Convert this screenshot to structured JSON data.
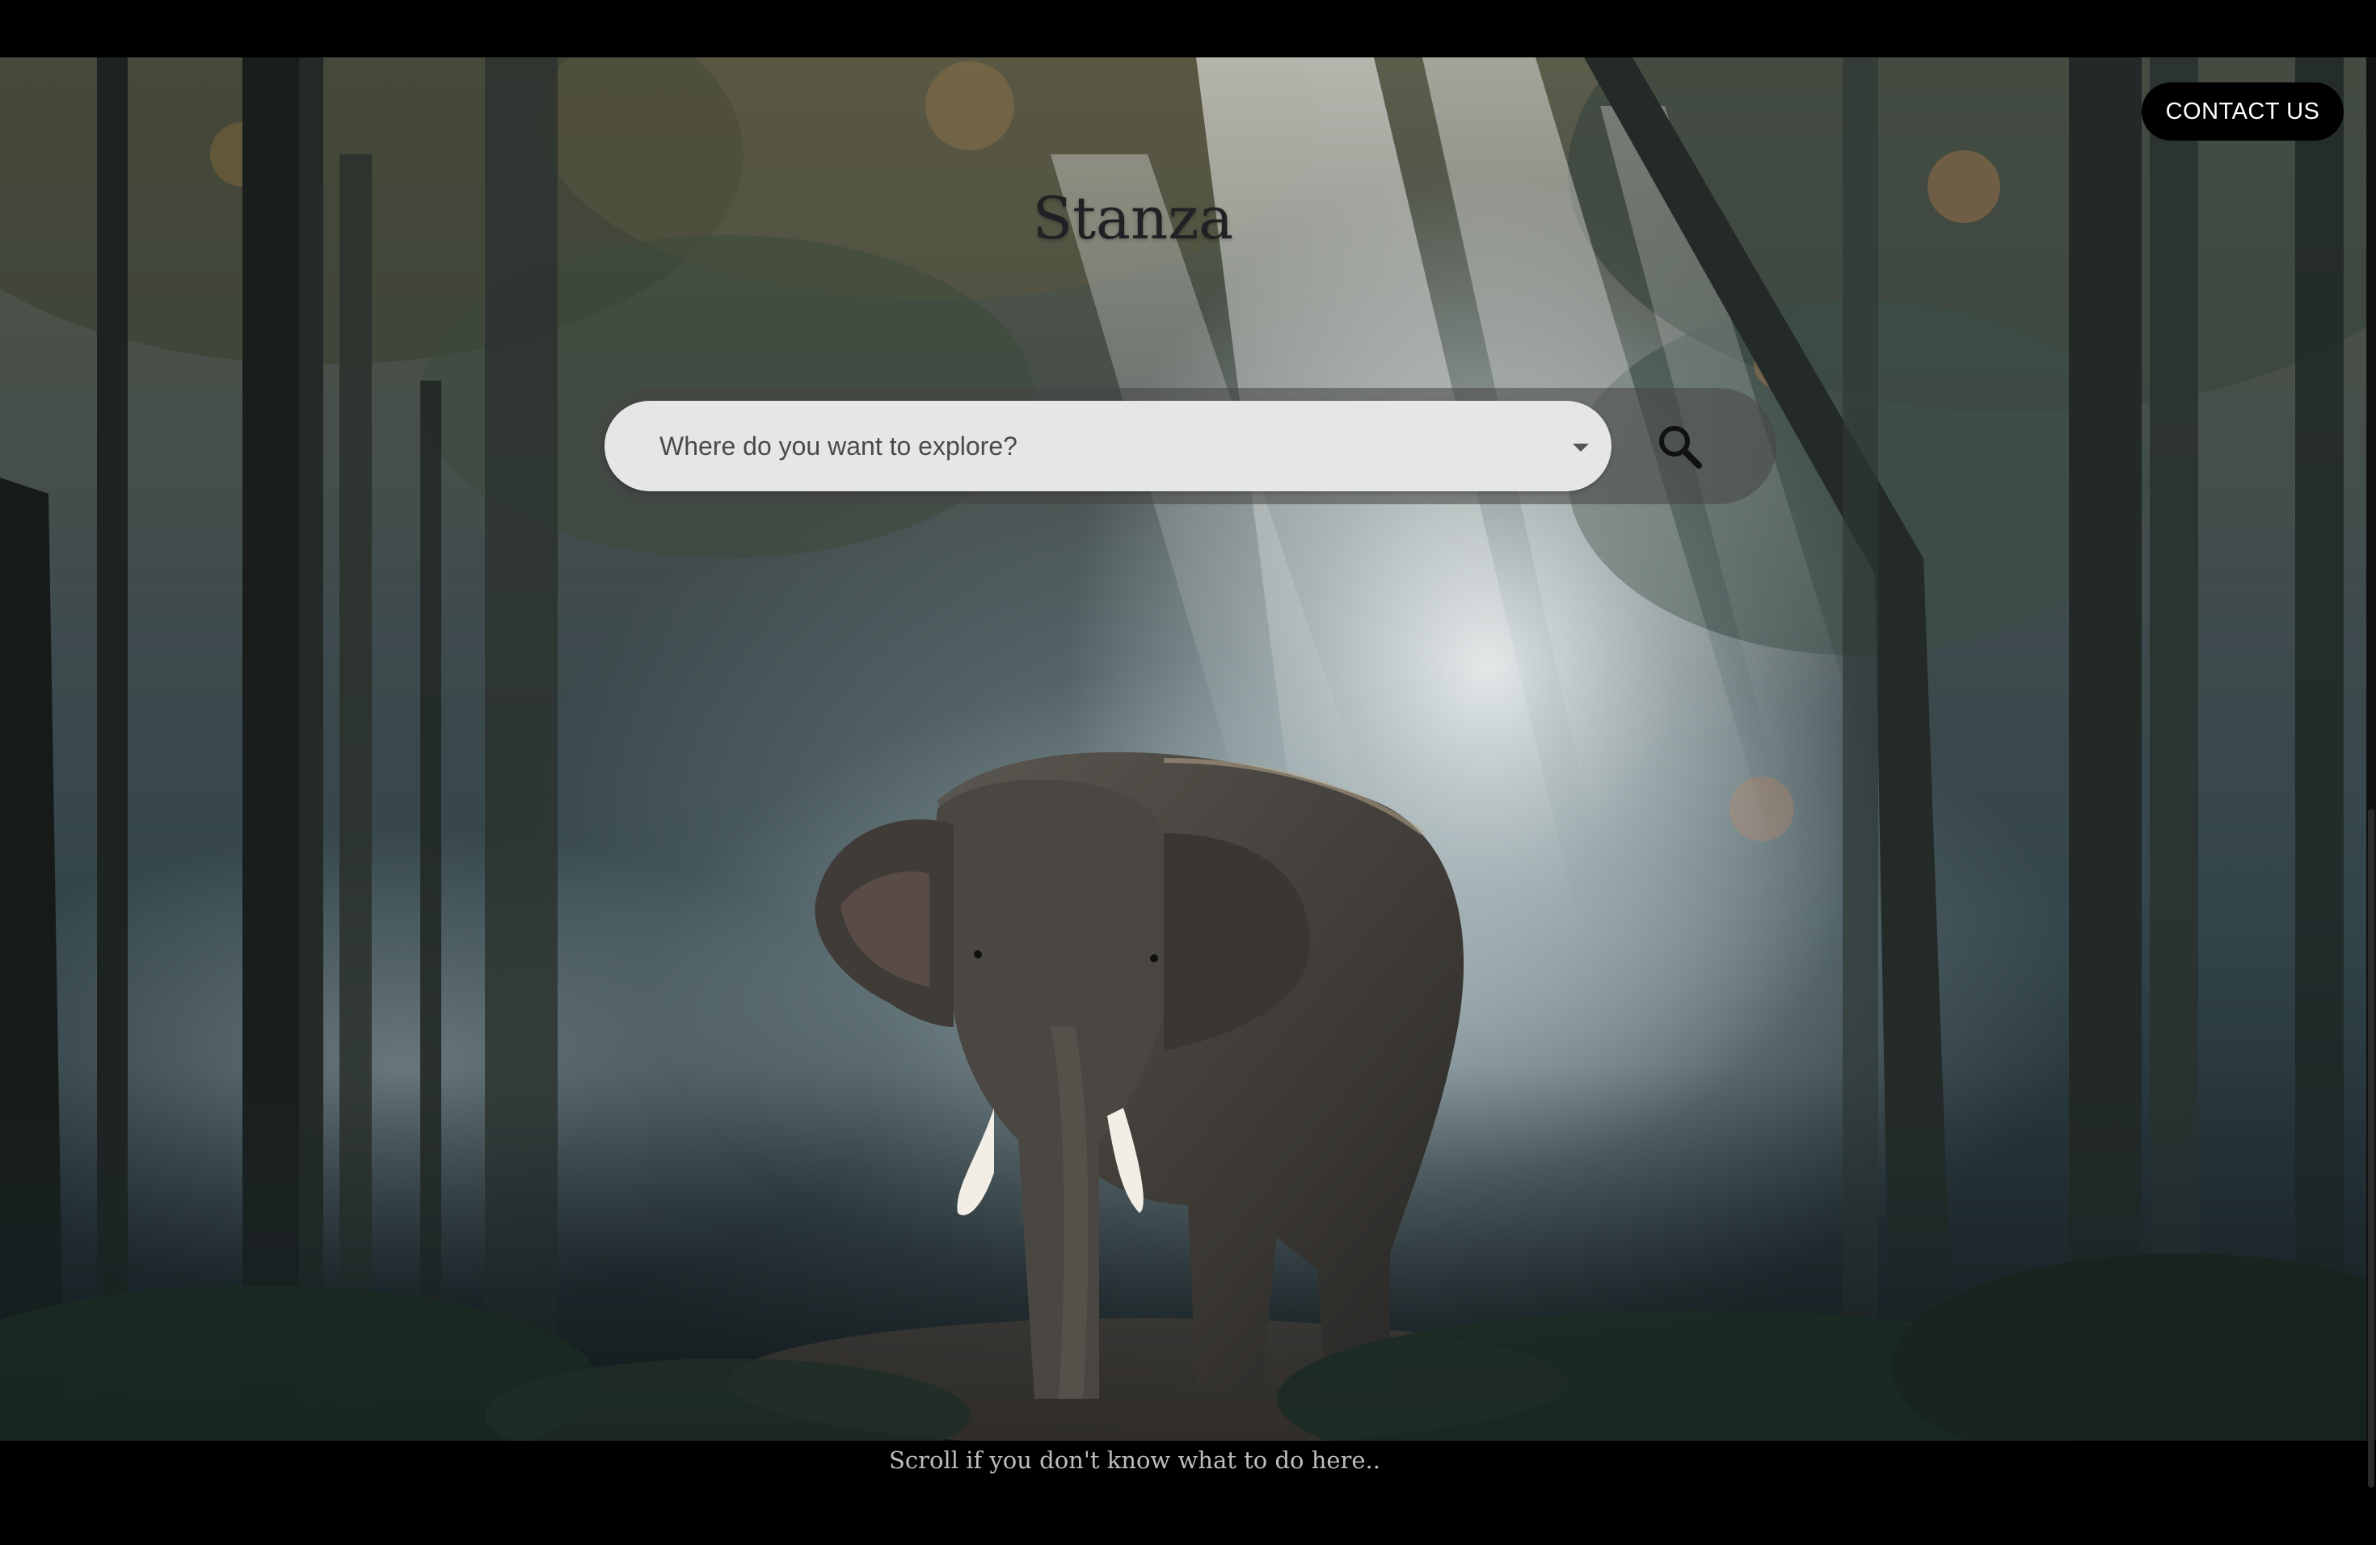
{
  "header": {
    "brand": "Stanza",
    "contact_label": "CONTACT US"
  },
  "search": {
    "placeholder": "Where do you want to explore?",
    "dropdown_icon": "caret-down-icon",
    "button_icon": "search-icon"
  },
  "hero": {
    "image": "elephant-in-forest-photo"
  },
  "footer": {
    "hint": "Scroll if you don't know what to do here.."
  },
  "colors": {
    "page_background": "#000000",
    "button_background": "#000000",
    "button_text": "#ffffff",
    "search_field": "#e6e6e6",
    "title": "#1f2124",
    "hint_text": "#bdbdbd"
  }
}
